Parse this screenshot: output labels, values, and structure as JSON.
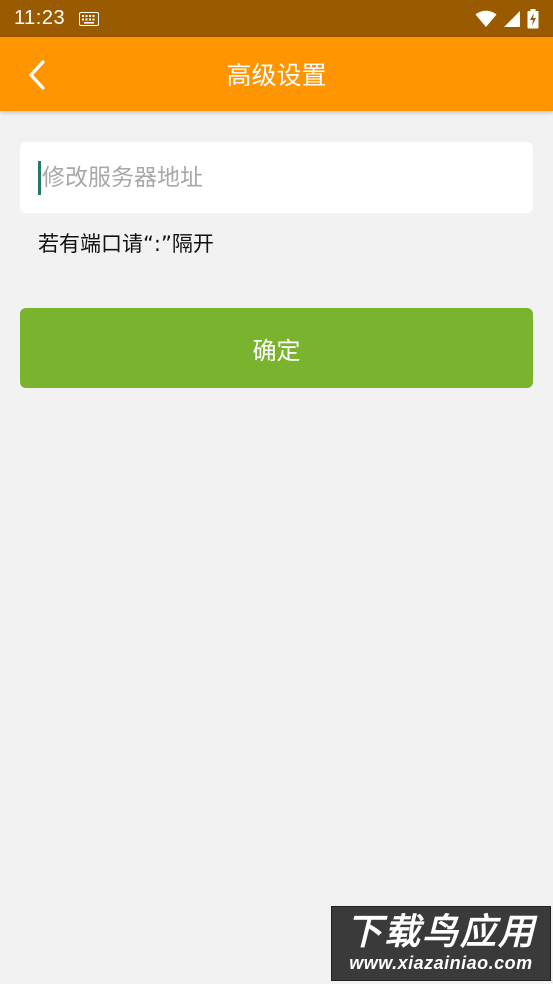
{
  "status_bar": {
    "time": "11:23",
    "icons": [
      "keyboard-icon",
      "wifi-icon",
      "signal-icon",
      "battery-charging-icon"
    ]
  },
  "app_bar": {
    "back_icon": "chevron-left-icon",
    "title": "高级设置"
  },
  "form": {
    "server_input": {
      "value": "",
      "placeholder": "修改服务器地址"
    },
    "hint": "若有端口请“:”隔开",
    "confirm_label": "确定"
  },
  "watermark": {
    "main": "下载鸟应用",
    "url": "www.xiazainiao.com"
  },
  "colors": {
    "status_bar": "#9a5b00",
    "app_bar": "#ff9500",
    "background": "#f2f2f2",
    "confirm_button": "#7ab32e",
    "caret": "#1f7a6c"
  }
}
